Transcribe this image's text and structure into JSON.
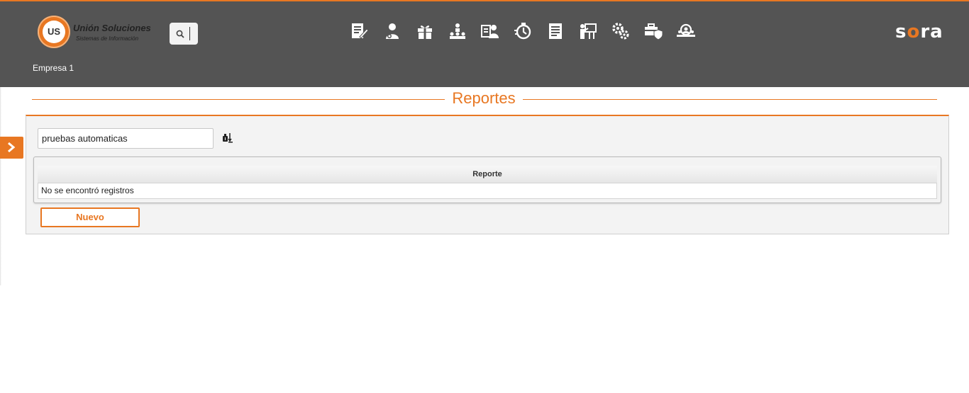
{
  "header": {
    "logo": {
      "badge_text": "US",
      "title": "Unión Soluciones",
      "subtitle": "Sistemas de Información"
    },
    "search_icon": "search-icon",
    "nav_icons": [
      "document-edit-icon",
      "user-settings-icon",
      "gift-icon",
      "hierarchy-icon",
      "user-id-icon",
      "timer-icon",
      "report-list-icon",
      "presentation-icon",
      "gears-icon",
      "toolbox-shield-icon",
      "people-search-icon"
    ],
    "brand": {
      "prefix": "s",
      "accent": "o",
      "suffix": "ra"
    },
    "company": "Empresa 1"
  },
  "page": {
    "title": "Reportes"
  },
  "filter": {
    "value": "pruebas  automaticas",
    "icon": "sort-filter-icon"
  },
  "table": {
    "columns": [
      "Reporte"
    ],
    "empty_message": "No se encontró registros"
  },
  "actions": {
    "new_label": "Nuevo"
  },
  "sidebar": {
    "toggle_icon": "chevron-right-icon"
  },
  "colors": {
    "accent": "#e87722",
    "header_bg": "#545454"
  }
}
